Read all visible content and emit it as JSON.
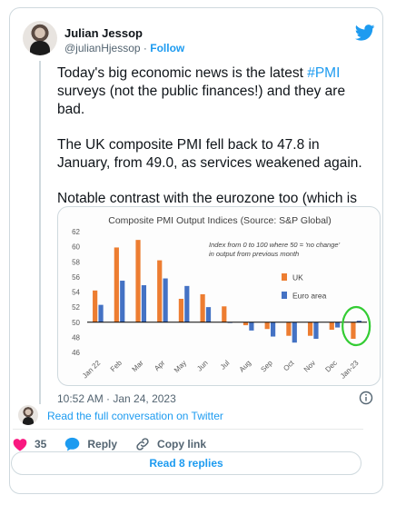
{
  "author": {
    "name": "Julian Jessop",
    "handle": "@julianHjessop",
    "separator": "·",
    "follow_label": "Follow"
  },
  "tweet": {
    "para1_pre": "Today's big economic news is the latest ",
    "para1_hashtag": "#PMI",
    "para1_post": " surveys (not the public finances!) and they are bad.",
    "para2": "The UK composite PMI fell back to 47.8 in January, from 49.0, as services weakened again.",
    "para3": "Notable contrast with the eurozone too (which is also reflected in consumer confidence)."
  },
  "meta": {
    "timestamp": "10:52 AM · Jan 24, 2023"
  },
  "conversation": {
    "link_label": "Read the full conversation on Twitter"
  },
  "actions": {
    "likes_count": "35",
    "reply_label": "Reply",
    "copy_link_label": "Copy link",
    "read_replies_label": "Read 8 replies"
  },
  "colors": {
    "accent": "#1d9bf0",
    "heart": "#f91880",
    "uk": "#ed7d31",
    "euro": "#4472c4",
    "highlight": "#33cc33"
  },
  "chart_data": {
    "type": "bar",
    "title": "Composite PMI Output Indices (Source: S&P Global)",
    "annotation_line1": "Index from 0 to 100 where 50 = 'no change'",
    "annotation_line2": "in output from previous month",
    "baseline": 50,
    "ylim": [
      46,
      62
    ],
    "yticks": [
      46,
      48,
      50,
      52,
      54,
      56,
      58,
      60,
      62
    ],
    "categories": [
      "Jan 22",
      "Feb",
      "Mar",
      "Apr",
      "May",
      "Jun",
      "Jul",
      "Aug",
      "Sep",
      "Oct",
      "Nov",
      "Dec",
      "Jan-23"
    ],
    "series": [
      {
        "name": "UK",
        "color": "#ed7d31",
        "values": [
          54.2,
          59.9,
          60.9,
          58.2,
          53.1,
          53.7,
          52.1,
          49.6,
          49.1,
          48.2,
          48.2,
          49.0,
          47.8
        ]
      },
      {
        "name": "Euro area",
        "color": "#4472c4",
        "values": [
          52.3,
          55.5,
          54.9,
          55.8,
          54.8,
          52.0,
          49.9,
          48.9,
          48.1,
          47.3,
          47.8,
          49.3,
          50.2
        ]
      }
    ],
    "legend": "right",
    "grid": false
  }
}
